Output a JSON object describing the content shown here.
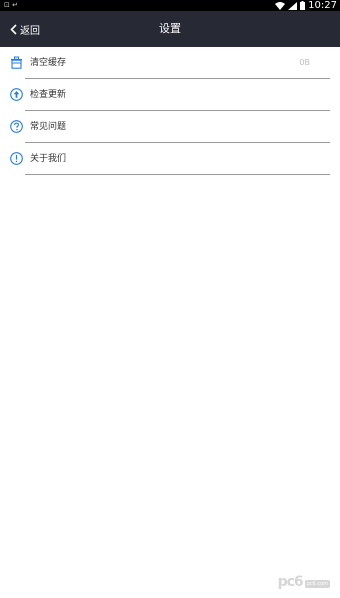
{
  "status_bar": {
    "left_text": "⊡ ↵",
    "time": "10:27"
  },
  "nav": {
    "back_label": "返回",
    "title": "设置"
  },
  "settings": {
    "items": [
      {
        "label": "清空缓存",
        "value": "0B",
        "icon": "trash-icon"
      },
      {
        "label": "检查更新",
        "value": "",
        "icon": "upload-arrow-icon"
      },
      {
        "label": "常见问题",
        "value": "",
        "icon": "question-icon"
      },
      {
        "label": "关于我们",
        "value": "",
        "icon": "info-icon"
      }
    ]
  },
  "watermark": {
    "text": "pc6",
    "sub": "pc6.com"
  },
  "colors": {
    "navbar": "#272a35",
    "icon_blue": "#2a7ed8",
    "divider": "#9a9a9a"
  }
}
